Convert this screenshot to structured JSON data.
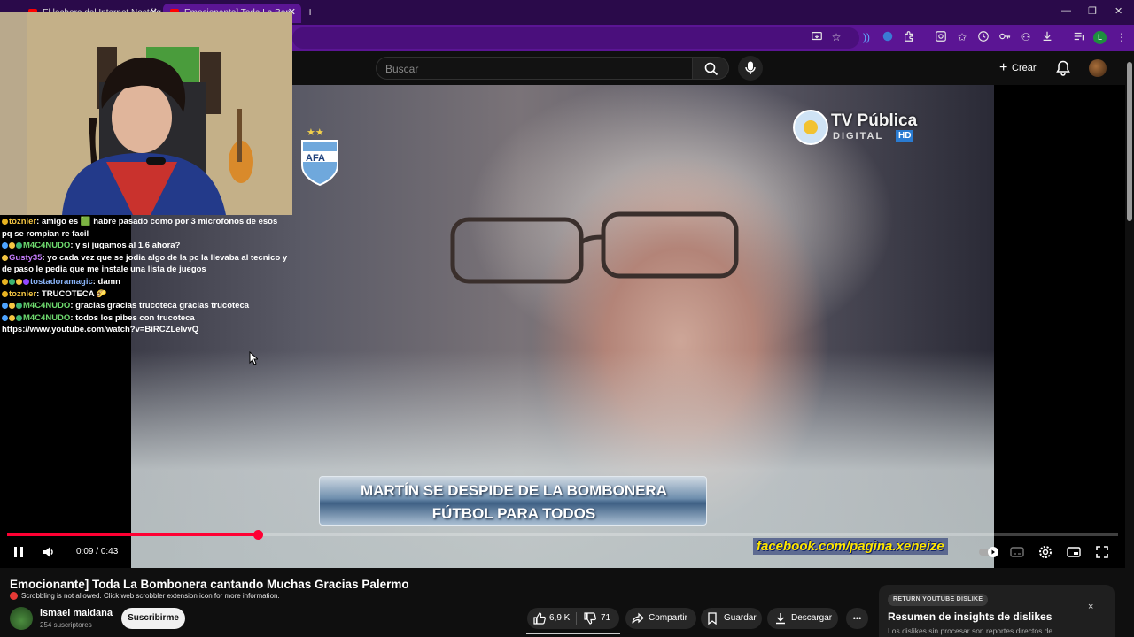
{
  "browser": {
    "tabs": [
      {
        "label": "El lechero del Internet Nostálg",
        "active": false
      },
      {
        "label": "Emocionante] Toda La Bom",
        "active": true
      }
    ],
    "new_tab": "+",
    "window_controls": {
      "minimize": "—",
      "maximize": "❐",
      "close": "✕"
    },
    "profile_initial": "L",
    "colors": {
      "tabbar": "#2a0a4a",
      "toolbar": "#5b1594"
    }
  },
  "youtube": {
    "search": {
      "placeholder": "Buscar"
    },
    "create_label": "Crear"
  },
  "video": {
    "overlay": {
      "channel_logo": "TV Pública",
      "channel_sub": "DIGITAL",
      "channel_hd": "HD",
      "lower_third_line1": "MARTÍN SE DESPIDE DE LA BOMBONERA",
      "lower_third_line2": "FÚTBOL PARA TODOS",
      "facebook_tag": "facebook.com/pagina.xeneize"
    },
    "time_current": "0:09",
    "time_total": "0:43",
    "time_separator": " / ",
    "progress": 0.226,
    "accent": "#ff0033"
  },
  "chat": {
    "messages": [
      {
        "user": "toznier",
        "user_color": "#f4c542",
        "badges": [
          "#e8b321"
        ],
        "text": ": amigo es 🟩 habre pasado como por 3 microfonos de esos pq se rompian re facil"
      },
      {
        "user": "M4C4NUDO",
        "user_color": "#6fdc6f",
        "badges": [
          "#4da3ff",
          "#f4c542",
          "#3cb371"
        ],
        "text": ": y si jugamos al 1.6 ahora?"
      },
      {
        "user": "Gusty35",
        "user_color": "#c77dff",
        "badges": [
          "#f4c542"
        ],
        "text": ": yo cada vez que se jodia algo de la pc la llevaba al tecnico y de paso le pedia que me instale una lista de juegos"
      },
      {
        "user": "tostadoramagic",
        "user_color": "#8ab4f8",
        "badges": [
          "#e8b321",
          "#3cb371",
          "#f4c542",
          "#9146ff"
        ],
        "text": ": damn"
      },
      {
        "user": "toznier",
        "user_color": "#f4c542",
        "badges": [
          "#e8b321"
        ],
        "text": ": TRUCOTECA 🌮"
      },
      {
        "user": "M4C4NUDO",
        "user_color": "#6fdc6f",
        "badges": [
          "#4da3ff",
          "#f4c542",
          "#3cb371"
        ],
        "text": ": gracias gracias trucoteca gracias trucoteca"
      },
      {
        "user": "M4C4NUDO",
        "user_color": "#6fdc6f",
        "badges": [
          "#4da3ff",
          "#f4c542",
          "#3cb371"
        ],
        "text": ": todos los pibes con trucoteca https://www.youtube.com/watch?v=BiRCZLeIvvQ"
      }
    ]
  },
  "below": {
    "title": "Emocionante] Toda La Bombonera cantando Muchas Gracias Palermo",
    "scrobble_notice": "Scrobbling is not allowed. Click web scrobbler extension icon for more information.",
    "channel_name": "ismael maidana",
    "subscribers": "254 suscriptores",
    "subscribe_label": "Suscribirme",
    "likes": "6,9 K",
    "dislikes": "71",
    "share_label": "Compartir",
    "save_label": "Guardar",
    "download_label": "Descargar",
    "more_label": "•••"
  },
  "ryd_panel": {
    "tag": "RETURN YOUTUBE DISLIKE",
    "title": "Resumen de insights de dislikes",
    "description": "Los dislikes sin procesar son reportes directos de",
    "close": "×"
  }
}
